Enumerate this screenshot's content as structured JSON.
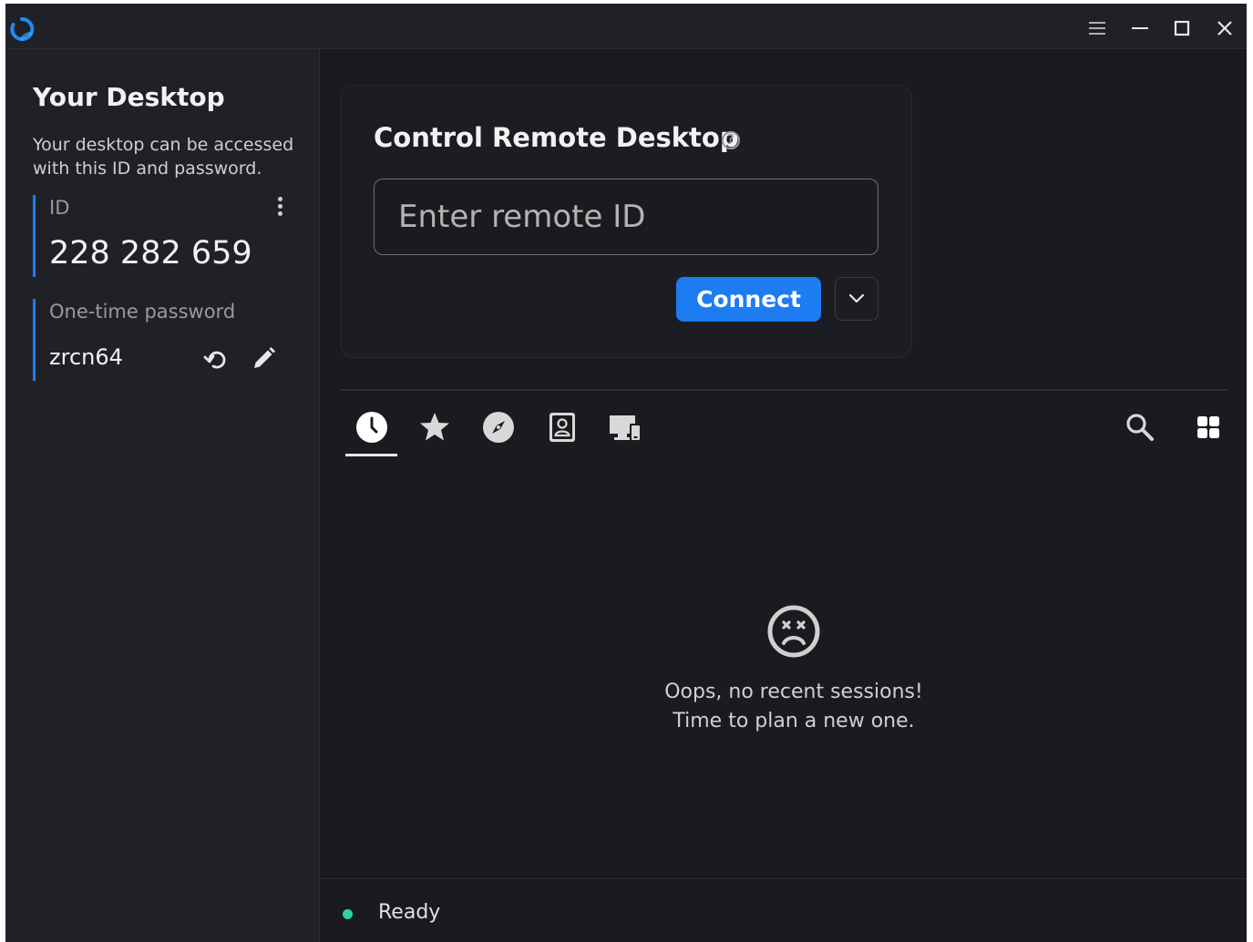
{
  "sidebar": {
    "title": "Your Desktop",
    "description": "Your desktop can be accessed with this ID and password.",
    "id_label": "ID",
    "id_value": "228 282 659",
    "password_label": "One-time password",
    "password_value": "zrcn64"
  },
  "connect_card": {
    "title": "Control Remote Desktop",
    "input_placeholder": "Enter remote ID",
    "input_value": "",
    "connect_label": "Connect"
  },
  "tabs": [
    {
      "icon": "clock-icon",
      "active": true
    },
    {
      "icon": "star-icon",
      "active": false
    },
    {
      "icon": "compass-icon",
      "active": false
    },
    {
      "icon": "address-book-icon",
      "active": false
    },
    {
      "icon": "devices-icon",
      "active": false
    }
  ],
  "empty_state": {
    "line1": "Oops, no recent sessions!",
    "line2": "Time to plan a new one."
  },
  "status": {
    "text": "Ready",
    "color": "#2dd2a8"
  },
  "colors": {
    "accent": "#1e7cf2",
    "background": "#1a1b1f",
    "sidebar": "#202126"
  }
}
